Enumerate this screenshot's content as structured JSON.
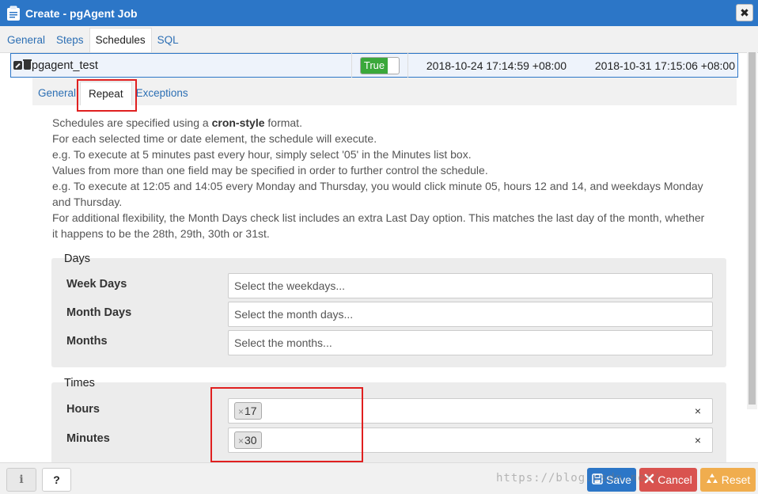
{
  "window": {
    "title": "Create - pgAgent Job",
    "close_symbol": "✖"
  },
  "main_tabs": [
    {
      "label": "General",
      "active": false
    },
    {
      "label": "Steps",
      "active": false
    },
    {
      "label": "Schedules",
      "active": true
    },
    {
      "label": "SQL",
      "active": false
    }
  ],
  "schedule_row": {
    "name": "pgagent_test",
    "enabled": "True",
    "start": "2018-10-24 17:14:59 +08:00",
    "end": "2018-10-31 17:15:06 +08:00"
  },
  "sub_tabs": [
    {
      "label": "General",
      "active": false
    },
    {
      "label": "Repeat",
      "active": true
    },
    {
      "label": "Exceptions",
      "active": false
    }
  ],
  "help": {
    "line1_pre": "Schedules are specified using a ",
    "line1_bold": "cron-style",
    "line1_post": " format.",
    "line2": "For each selected time or date element, the schedule will execute.",
    "line3": "e.g. To execute at 5 minutes past every hour, simply select '05' in the Minutes list box.",
    "line4": "Values from more than one field may be specified in order to further control the schedule.",
    "line5": "e.g. To execute at 12:05 and 14:05 every Monday and Thursday, you would click minute 05, hours 12 and 14, and weekdays Monday and Thursday.",
    "line6": "For additional flexibility, the Month Days check list includes an extra Last Day option. This matches the last day of the month, whether it happens to be the 28th, 29th, 30th or 31st."
  },
  "days": {
    "legend": "Days",
    "week_days": {
      "label": "Week Days",
      "placeholder": "Select the weekdays..."
    },
    "month_days": {
      "label": "Month Days",
      "placeholder": "Select the month days..."
    },
    "months": {
      "label": "Months",
      "placeholder": "Select the months..."
    }
  },
  "times": {
    "legend": "Times",
    "hours": {
      "label": "Hours",
      "chip": "17",
      "chip_x": "×",
      "clear": "×"
    },
    "minutes": {
      "label": "Minutes",
      "chip": "30",
      "chip_x": "×",
      "clear": "×"
    }
  },
  "footer": {
    "info": "i",
    "help": "?",
    "save": "Save",
    "cancel": "Cancel",
    "reset": "Reset"
  },
  "watermark": "https://blog.csdn.net/..."
}
